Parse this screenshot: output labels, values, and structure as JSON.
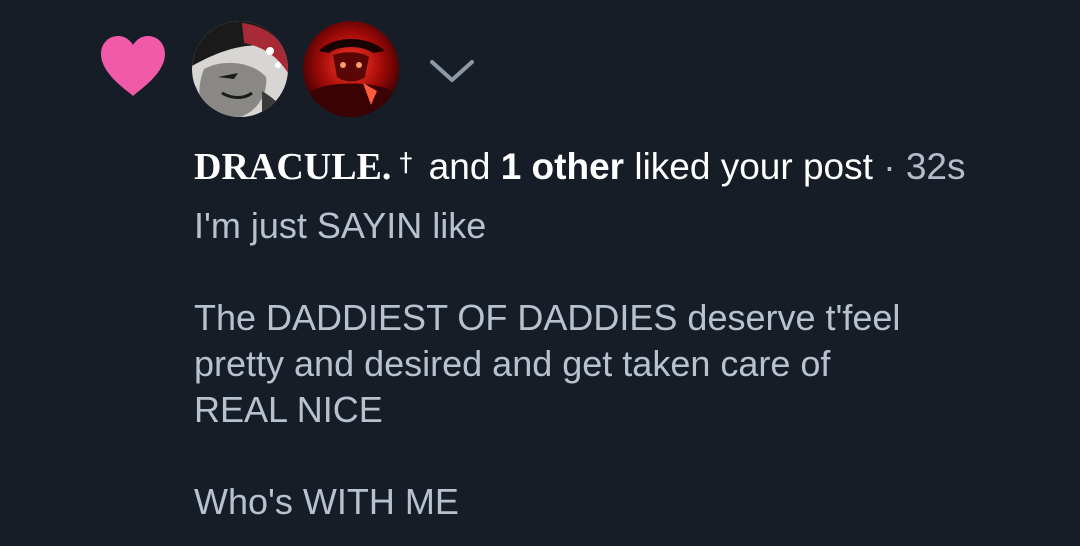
{
  "notification": {
    "type_icon": "heart-icon",
    "heart_color": "#f05aa8",
    "avatars": [
      {
        "icon": "avatar-dracule"
      },
      {
        "icon": "avatar-red-figure"
      }
    ],
    "expand_icon": "chevron-down-icon",
    "username": "DRACULE.",
    "username_symbol": "†",
    "connector": " and ",
    "others": "1 other",
    "action": " liked your post",
    "separator": " · ",
    "timestamp": "32s",
    "post_text": [
      "I'm just SAYIN like",
      "The DADDIEST OF DADDIES deserve t'feel\npretty and desired and get taken care of\nREAL NICE",
      "Who's WITH ME"
    ]
  }
}
